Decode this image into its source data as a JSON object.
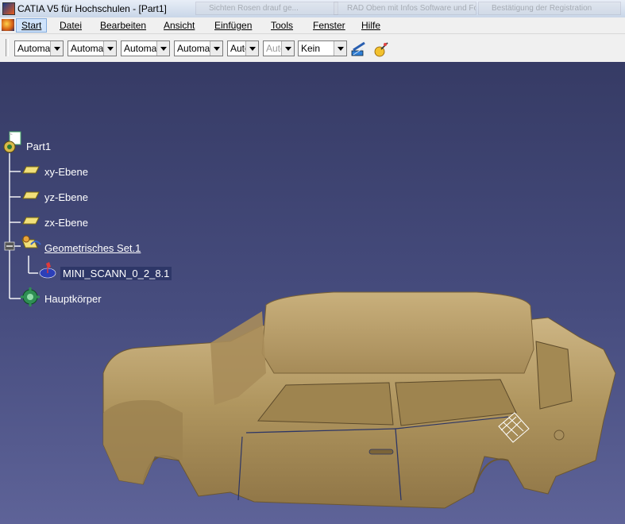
{
  "window": {
    "title": "CATIA V5 für Hochschulen - [Part1]",
    "background_tabs": [
      "Sichten Rosen drauf ge...",
      "RAD Oben mit Infos Software und Fo...",
      "Bestätigung der Registration"
    ]
  },
  "menubar": {
    "items": [
      {
        "label": "Start",
        "active": true
      },
      {
        "label": "Datei",
        "active": false
      },
      {
        "label": "Bearbeiten",
        "active": false
      },
      {
        "label": "Ansicht",
        "active": false
      },
      {
        "label": "Einfügen",
        "active": false
      },
      {
        "label": "Tools",
        "active": false
      },
      {
        "label": "Fenster",
        "active": false
      },
      {
        "label": "Hilfe",
        "active": false
      }
    ]
  },
  "toolbar": {
    "combos": [
      {
        "value": "Automatisch",
        "enabled": true
      },
      {
        "value": "Automatisch",
        "enabled": true
      },
      {
        "value": "Automatisch",
        "enabled": true
      },
      {
        "value": "Automatisch",
        "enabled": true
      },
      {
        "value": "Auto",
        "enabled": true
      },
      {
        "value": "Auto",
        "enabled": false
      },
      {
        "value": "Kein",
        "enabled": true
      }
    ],
    "icons": [
      "painter-brush-icon",
      "magic-wand-icon"
    ]
  },
  "tree": {
    "root": "Part1",
    "nodes": [
      {
        "label": "xy-Ebene",
        "icon": "plane-icon"
      },
      {
        "label": "yz-Ebene",
        "icon": "plane-icon"
      },
      {
        "label": "zx-Ebene",
        "icon": "plane-icon"
      },
      {
        "label": "Geometrisches Set.1",
        "icon": "geometric-set-icon",
        "expanded": true
      },
      {
        "label": "MINI_SCANN_0_2_8.1",
        "icon": "scan-mesh-icon"
      },
      {
        "label": "Hauptkörper",
        "icon": "body-gear-icon"
      }
    ]
  },
  "colors": {
    "viewport_top": "#363b65",
    "viewport_bottom": "#5e6398",
    "model": "#b39a68",
    "tree_text": "#ffffff"
  }
}
